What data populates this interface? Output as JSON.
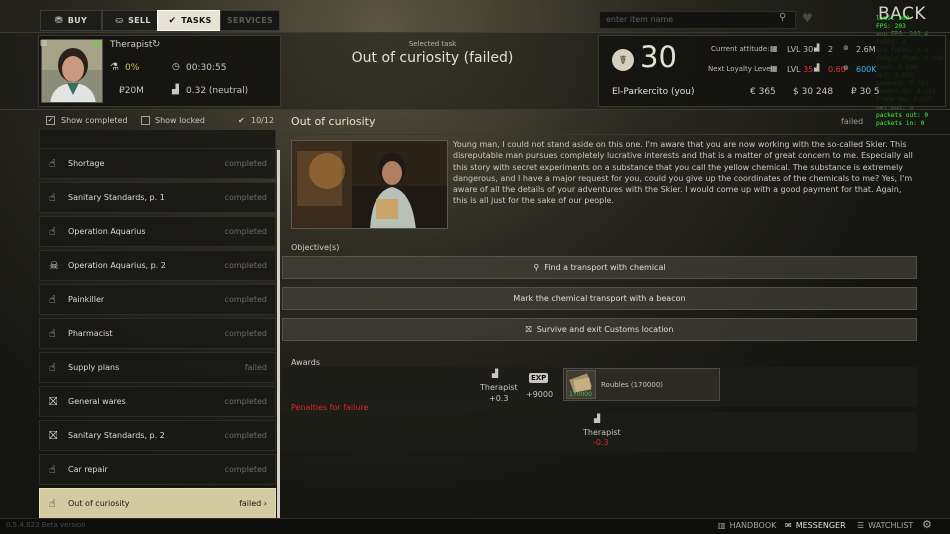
{
  "tabs": [
    {
      "label": "BUY",
      "icon": "buy-icon"
    },
    {
      "label": "SELL",
      "icon": "sell-icon"
    },
    {
      "label": "TASKS",
      "icon": "tasks-icon"
    },
    {
      "label": "SERVICES",
      "icon": ""
    }
  ],
  "search": {
    "placeholder": "enter item name"
  },
  "back_label": "BACK",
  "debug_overlay": "limit 300\nFPS: 203\navg FPS: 203.4\nfuFPS: 0\navg fuFPS: 0.4\nsingle fUpd: 0.039\nfUpd: 0.098\nUpd: 0.856\ngameUpd: 0.753\nrender ms: 4.162\nframe ms: 4.917\nnet out: 0\npackets out: 0\npackets in: 0",
  "trader": {
    "name": "Therapist",
    "discount": "0%",
    "restock_timer": "00:30:55",
    "money": "₽20M",
    "standing": "0.32 (neutral)"
  },
  "selected_task": {
    "caption": "Selected task",
    "title": "Out of curiosity (failed)"
  },
  "player": {
    "level": "30",
    "name": "El-Parkercito (you)",
    "current_attitude_label": "Current attitude:",
    "next_loyalty_label": "Next Loyalty Level:",
    "current": {
      "lvl": "LVL 30",
      "rep": "2",
      "money": "2.6M",
      "extra": "35"
    },
    "next": {
      "lvl": "LVL 35",
      "rep": "0.60",
      "money": "600K",
      "extra": "3"
    },
    "balances": [
      "€ 365",
      "$ 30 248",
      "₽ 30 5"
    ]
  },
  "filters": {
    "show_completed": "Show completed",
    "show_locked": "Show locked",
    "count": "10/12"
  },
  "tasks": [
    {
      "name": "Shortage",
      "status": "completed",
      "icon": "hand-icon"
    },
    {
      "name": "Sanitary Standards, p. 1",
      "status": "completed",
      "icon": "hand-icon"
    },
    {
      "name": "Operation Aquarius",
      "status": "completed",
      "icon": "hand-icon"
    },
    {
      "name": "Operation Aquarius, p. 2",
      "status": "completed",
      "icon": "skull-icon"
    },
    {
      "name": "Painkiller",
      "status": "completed",
      "icon": "hand-icon"
    },
    {
      "name": "Pharmacist",
      "status": "completed",
      "icon": "hand-icon"
    },
    {
      "name": "Supply plans",
      "status": "failed",
      "icon": "hand-icon"
    },
    {
      "name": "General wares",
      "status": "completed",
      "icon": "exit-icon"
    },
    {
      "name": "Sanitary Standards, p. 2",
      "status": "completed",
      "icon": "exit-icon"
    },
    {
      "name": "Car repair",
      "status": "completed",
      "icon": "hand-icon"
    },
    {
      "name": "Out of curiosity",
      "status": "failed",
      "icon": "hand-icon"
    }
  ],
  "task_detail": {
    "title": "Out of curiosity",
    "status": "failed",
    "description": "Young man, I could not stand aside on this one. I'm aware that you are now working with the so-called Skier. This disreputable man pursues completely lucrative interests and that is a matter of great concern to me. Especially all this story with secret experiments on a substance that you call the yellow chemical. The substance is extremely dangerous, and I have a major request for you, could you give up the coordinates of the chemicals to me? Yes, I'm aware of all the details of your adventures with the Skier. I would come up with a good payment for that. Again, this is all just for the sake of our people.",
    "objectives_label": "Objective(s)",
    "objectives": [
      {
        "text": "Find a transport with chemical",
        "icon": "search-icon"
      },
      {
        "text": "Mark the chemical transport with a beacon",
        "icon": ""
      },
      {
        "text": "Survive and exit Customs location",
        "icon": "exit-icon"
      }
    ],
    "awards_label": "Awards",
    "awards": {
      "trader": "Therapist",
      "rep": "+0.3",
      "exp_badge": "EXP",
      "exp": "+9000",
      "item_name": "Roubles (170000)",
      "item_count": "170000"
    },
    "penalties_label": "Penalties for failure",
    "penalties": {
      "trader": "Therapist",
      "rep": "-0.3"
    }
  },
  "bottom": {
    "version": "0.5.4.823 Beta version",
    "handbook": "HANDBOOK",
    "messenger": "MESSENGER",
    "watchlist": "WATCHLIST"
  },
  "colors": {
    "accent": "#d2cba2",
    "failed_red": "#d9262a",
    "discount_yellow": "#d8c44e",
    "money_blue": "#3fb5f0"
  }
}
